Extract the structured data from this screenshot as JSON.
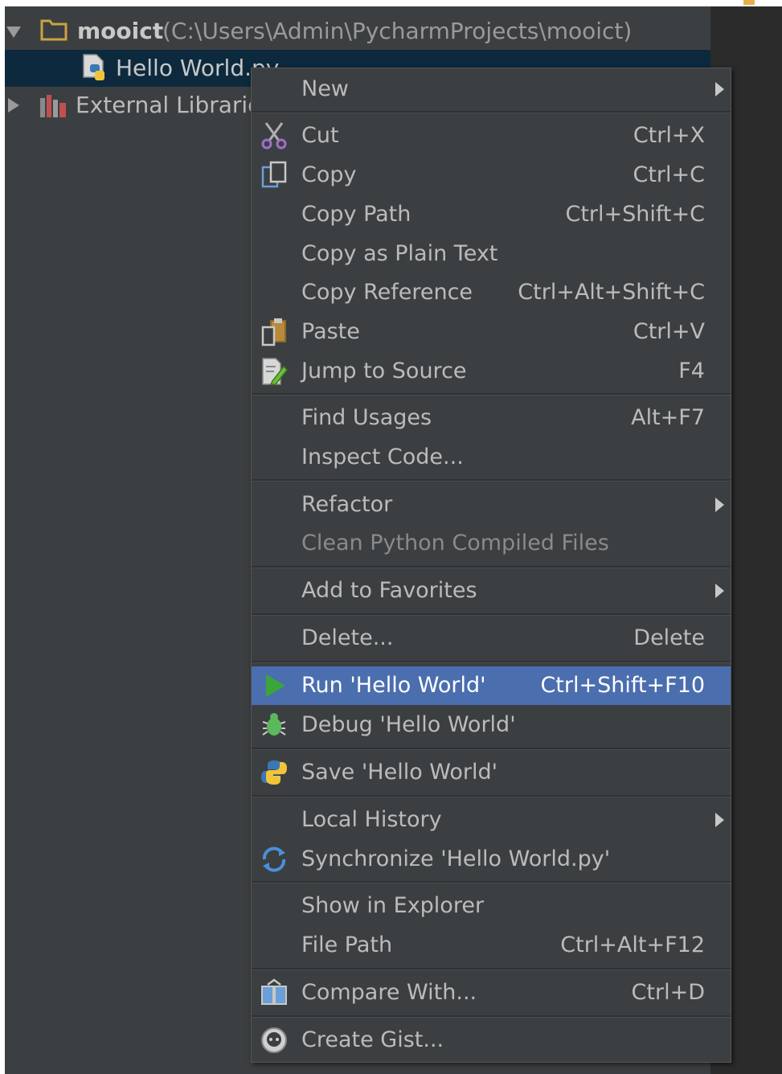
{
  "project_tree": {
    "root_name": "mooict",
    "root_path": "(C:\\Users\\Admin\\PycharmProjects\\mooict)",
    "file": "Hello World.py",
    "libraries": "External Libraries"
  },
  "context_menu": {
    "new": "New",
    "cut": "Cut",
    "cut_shortcut": "Ctrl+X",
    "copy": "Copy",
    "copy_shortcut": "Ctrl+C",
    "copy_path": "Copy Path",
    "copy_path_shortcut": "Ctrl+Shift+C",
    "copy_plain": "Copy as Plain Text",
    "copy_reference": "Copy Reference",
    "copy_reference_shortcut": "Ctrl+Alt+Shift+C",
    "paste": "Paste",
    "paste_shortcut": "Ctrl+V",
    "jump_to_source": "Jump to Source",
    "jump_to_source_shortcut": "F4",
    "find_usages": "Find Usages",
    "find_usages_shortcut": "Alt+F7",
    "inspect_code": "Inspect Code...",
    "refactor": "Refactor",
    "clean_compiled": "Clean Python Compiled Files",
    "add_favorites": "Add to Favorites",
    "delete": "Delete...",
    "delete_shortcut": "Delete",
    "run": "Run 'Hello World'",
    "run_shortcut": "Ctrl+Shift+F10",
    "debug": "Debug 'Hello World'",
    "save": "Save 'Hello World'",
    "local_history": "Local History",
    "synchronize": "Synchronize 'Hello World.py'",
    "show_explorer": "Show in Explorer",
    "file_path": "File Path",
    "file_path_shortcut": "Ctrl+Alt+F12",
    "compare_with": "Compare With...",
    "compare_with_shortcut": "Ctrl+D",
    "create_gist": "Create Gist..."
  },
  "colors": {
    "background": "#3c3f41",
    "selection": "#0d293e",
    "highlight": "#4b6eaf",
    "run_icon": "#3aa63a"
  }
}
